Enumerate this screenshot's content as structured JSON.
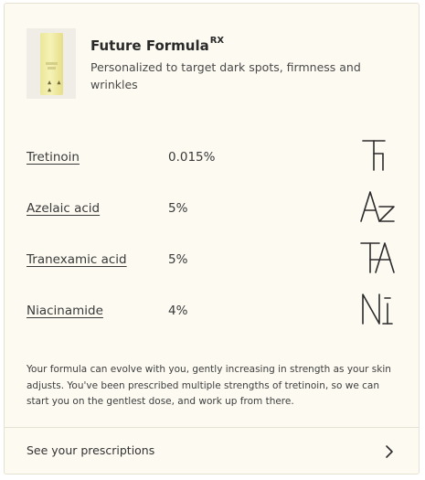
{
  "product": {
    "name": "Future Formula",
    "name_superscript": "RX",
    "description": "Personalized to target dark spots, firmness and wrinkles",
    "bottle_mark": "▲ ▲ ▲"
  },
  "ingredients": [
    {
      "name": "Tretinoin",
      "strength": "0.015%",
      "symbol_icon": "tr-symbol-icon"
    },
    {
      "name": "Azelaic acid",
      "strength": "5%",
      "symbol_icon": "az-symbol-icon"
    },
    {
      "name": "Tranexamic acid",
      "strength": "5%",
      "symbol_icon": "ta-symbol-icon"
    },
    {
      "name": "Niacinamide",
      "strength": "4%",
      "symbol_icon": "ni-symbol-icon"
    }
  ],
  "note": "Your formula can evolve with you, gently increasing in strength as your skin adjusts. You've been prescribed multiple strengths of tretinoin, so we can start you on the gentlest dose, and work up from there.",
  "footer": {
    "link_label": "See your prescriptions",
    "chevron_icon": "chevron-right-icon"
  },
  "colors": {
    "card_background": "#fcfaf1",
    "card_border": "#e6e2d3",
    "bottle": "#f0eaa4"
  }
}
